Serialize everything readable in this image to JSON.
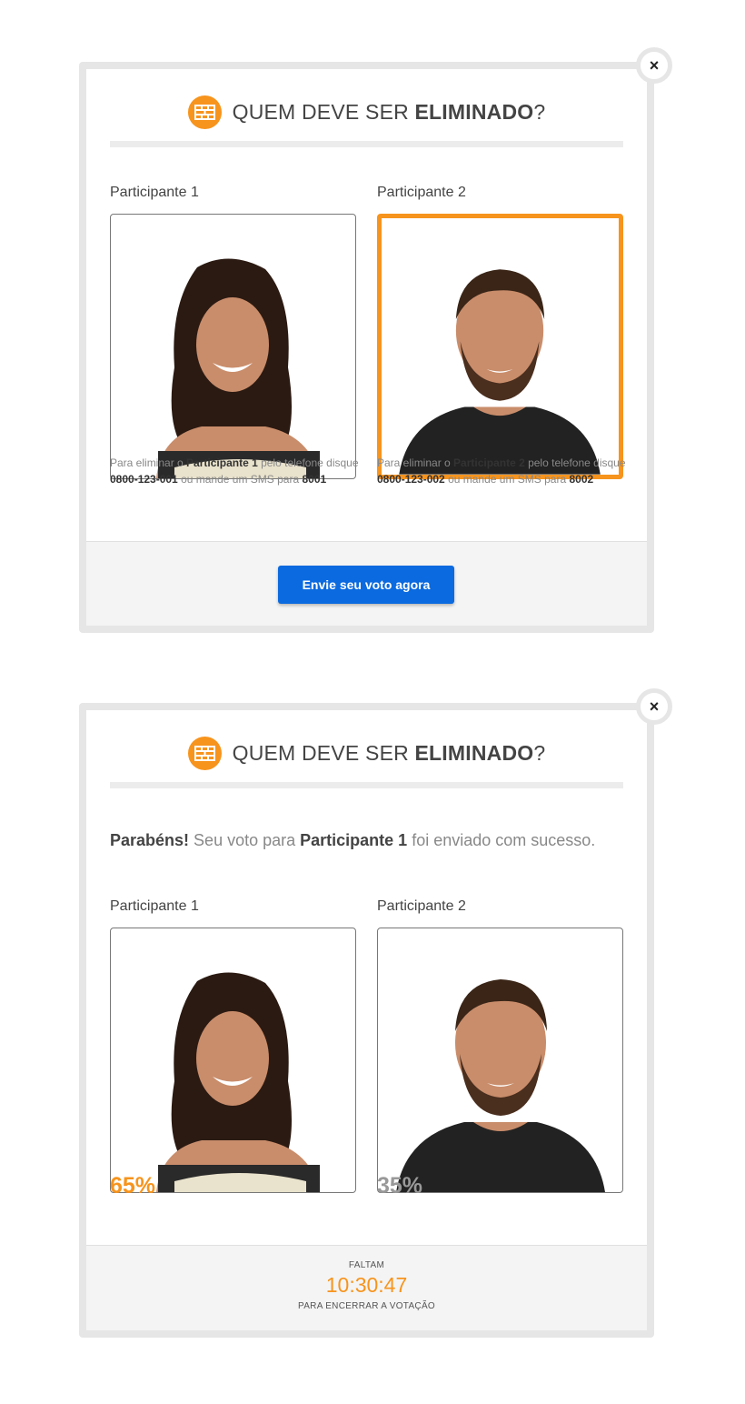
{
  "colors": {
    "accent": "#f7941d",
    "button": "#0b6adf",
    "frame": "#e6e6e6"
  },
  "icons": {
    "close": "close-icon",
    "brand": "brick-wall-icon"
  },
  "title": {
    "prefix": "QUEM DEVE SER ",
    "bold": "ELIMINADO",
    "suffix": "?"
  },
  "close_label": "×",
  "voting": {
    "participants": [
      {
        "label": "Participante 1",
        "selected": false,
        "instr": {
          "pre": "Para eliminar o ",
          "name": "Participante 1",
          "mid": " pelo telefone disque ",
          "phone": "0800-123-001",
          "sms_text": " ou mande um SMS para ",
          "sms": "8001"
        }
      },
      {
        "label": "Participante 2",
        "selected": true,
        "instr": {
          "pre": "Para eliminar o ",
          "name": "Participante 2",
          "mid": " pelo telefone disque ",
          "phone": "0800-123-002",
          "sms_text": " ou mande um SMS para ",
          "sms": "8002"
        }
      }
    ],
    "button_label": "Envie seu voto agora"
  },
  "result": {
    "congrats": {
      "bold": "Parabéns!",
      "text1": " Seu voto para ",
      "name": "Participante 1",
      "text2": " foi enviado com sucesso."
    },
    "participants": [
      {
        "label": "Participante 1",
        "percent": "65%"
      },
      {
        "label": "Participante 2",
        "percent": "35%"
      }
    ],
    "timer": {
      "top": "FALTAM",
      "time": "10:30:47",
      "bottom": "PARA ENCERRAR A VOTAÇÃO"
    }
  }
}
